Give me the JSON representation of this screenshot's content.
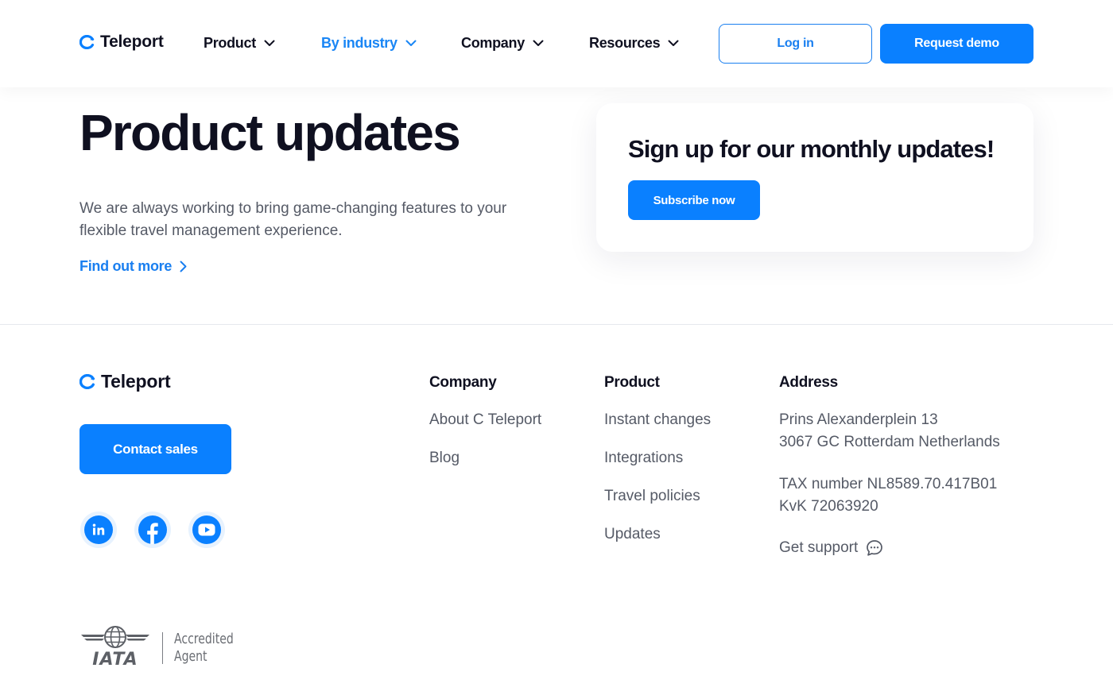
{
  "header": {
    "logo_text": "Teleport",
    "nav": [
      {
        "label": "Product",
        "active": false
      },
      {
        "label": "By industry",
        "active": true
      },
      {
        "label": "Company",
        "active": false
      },
      {
        "label": "Resources",
        "active": false
      }
    ],
    "login_label": "Log in",
    "demo_label": "Request demo"
  },
  "hero": {
    "title": "Product updates",
    "description": "We are always working to bring game-changing features to your flexible travel management experience.",
    "link_label": "Find out more"
  },
  "signup": {
    "title": "Sign up for our monthly updates!",
    "button_label": "Subscribe now"
  },
  "footer": {
    "logo_text": "Teleport",
    "contact_label": "Contact sales",
    "social": [
      "linkedin-icon",
      "facebook-icon",
      "youtube-icon"
    ],
    "columns": {
      "company": {
        "heading": "Company",
        "links": [
          "About C Teleport",
          "Blog"
        ]
      },
      "product": {
        "heading": "Product",
        "links": [
          "Instant changes",
          "Integrations",
          "Travel policies",
          "Updates"
        ]
      },
      "address": {
        "heading": "Address",
        "line1": "Prins Alexanderplein 13",
        "line2": "3067 GC Rotterdam Netherlands",
        "tax": "TAX number NL8589.70.417B01",
        "kvk": "KvK 72063920",
        "support_label": "Get support"
      }
    },
    "iata": {
      "word": "IATA",
      "line1": "Accredited",
      "line2": "Agent"
    }
  },
  "colors": {
    "brand_blue": "#0a80ff",
    "text_dark": "#0f1020",
    "text_muted": "#555a66"
  }
}
